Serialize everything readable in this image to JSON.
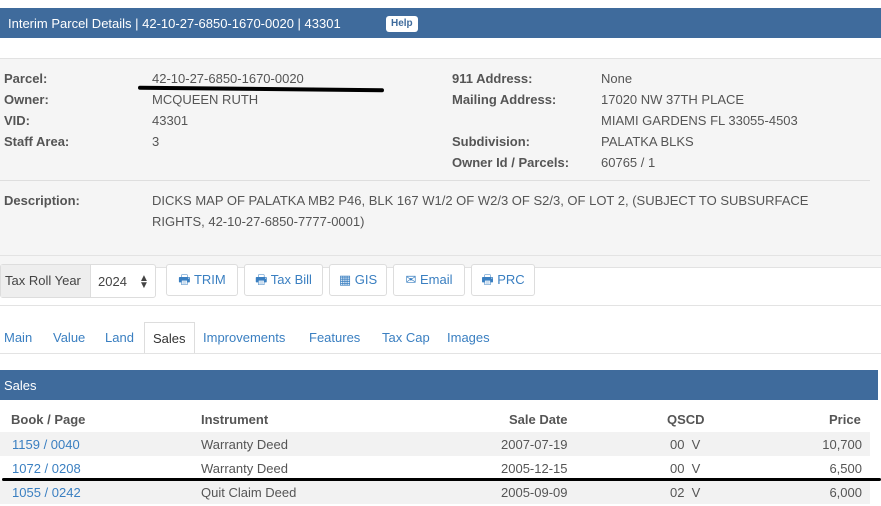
{
  "header": {
    "title": "Interim Parcel Details | 42-10-27-6850-1670-0020 | 43301",
    "help_label": "Help"
  },
  "parcel_info": {
    "parcel_label": "Parcel:",
    "parcel_value": "42-10-27-6850-1670-0020",
    "owner_label": "Owner:",
    "owner_value": "MCQUEEN RUTH",
    "vid_label": "VID:",
    "vid_value": "43301",
    "staff_label": "Staff Area:",
    "staff_value": "3",
    "address911_label": "911 Address:",
    "address911_value": "None",
    "mailing_label": "Mailing Address:",
    "mailing_line1": "17020 NW 37TH PLACE",
    "mailing_line2": "MIAMI GARDENS FL 33055-4503",
    "subdivision_label": "Subdivision:",
    "subdivision_value": "PALATKA BLKS",
    "ownerid_label": "Owner Id / Parcels:",
    "ownerid_value": "60765 / 1",
    "description_label": "Description:",
    "description_line1": "DICKS MAP OF PALATKA MB2 P46, BLK 167 W1/2 OF W2/3 OF S2/3, OF LOT 2, (SUBJECT TO SUBSURFACE",
    "description_line2": "RIGHTS, 42-10-27-6850-7777-0001)"
  },
  "toolbar": {
    "taxroll_label": "Tax Roll Year",
    "year_value": "2024",
    "trim_label": "TRIM",
    "taxbill_label": "Tax Bill",
    "gis_label": "GIS",
    "email_label": "Email",
    "prc_label": "PRC"
  },
  "tabs": [
    "Main",
    "Value",
    "Land",
    "Sales",
    "Improvements",
    "Features",
    "Tax Cap",
    "Images"
  ],
  "sales": {
    "section_title": "Sales",
    "columns": [
      "Book / Page",
      "Instrument",
      "Sale Date",
      "QSCD",
      "Price"
    ],
    "rows": [
      {
        "book": "1159 / 0040",
        "instrument": "Warranty Deed",
        "date": "2007-07-19",
        "qscd": "00  V",
        "price": "10,700"
      },
      {
        "book": "1072 / 0208",
        "instrument": "Warranty Deed",
        "date": "2005-12-15",
        "qscd": "00  V",
        "price": "6,500"
      },
      {
        "book": "1055 / 0242",
        "instrument": "Quit Claim Deed",
        "date": "2005-09-09",
        "qscd": "02  V",
        "price": "6,000"
      }
    ]
  },
  "colors": {
    "header_bg": "#3f6b9c",
    "link": "#3a7fc1"
  }
}
